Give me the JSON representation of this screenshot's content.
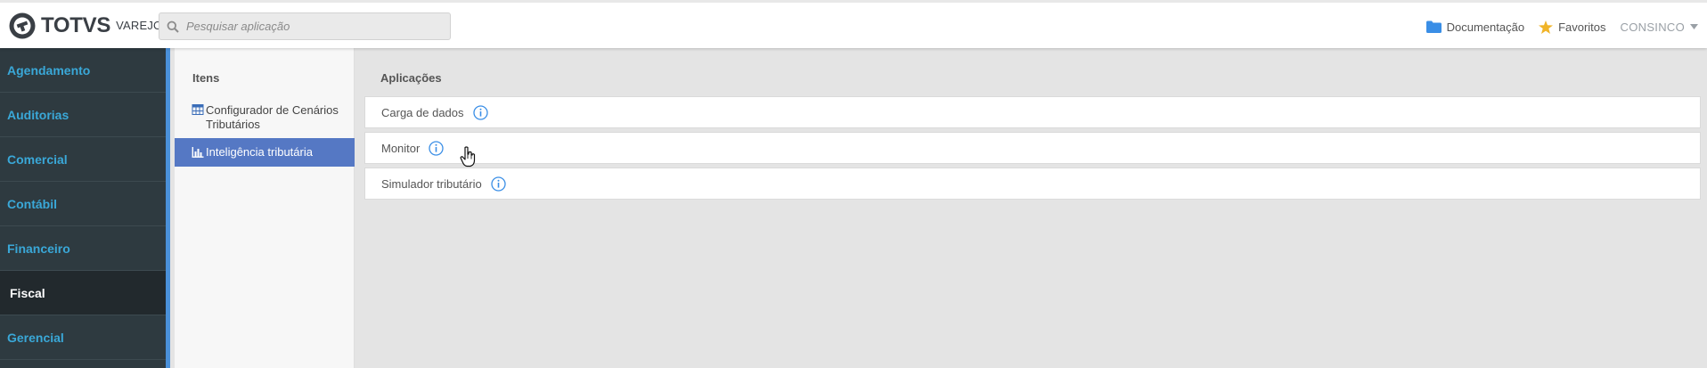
{
  "header": {
    "logo_text": "TOTVS",
    "logo_sub": "VAREJO",
    "search": {
      "placeholder": "Pesquisar aplicação"
    },
    "links": {
      "documentation": "Documentação",
      "favorites": "Favoritos",
      "user": "CONSINCO"
    }
  },
  "sidebar": {
    "items": [
      {
        "label": "Agendamento"
      },
      {
        "label": "Auditorias"
      },
      {
        "label": "Comercial"
      },
      {
        "label": "Contábil"
      },
      {
        "label": "Financeiro"
      },
      {
        "label": "Fiscal",
        "active": true
      },
      {
        "label": "Gerencial"
      }
    ]
  },
  "items_panel": {
    "title": "Itens",
    "items": [
      {
        "label": "Configurador de Cenários Tributários",
        "icon": "table-icon"
      },
      {
        "label": "Inteligência tributária",
        "icon": "bar-chart-icon",
        "active": true
      }
    ]
  },
  "content": {
    "title": "Aplicações",
    "apps": [
      {
        "label": "Carga de dados",
        "icon": "info-icon"
      },
      {
        "label": "Monitor",
        "icon": "info-icon"
      },
      {
        "label": "Simulador tributário",
        "icon": "info-icon"
      }
    ]
  },
  "colors": {
    "sidebar_bg": "#2e3a40",
    "sidebar_link": "#3aa8d8",
    "sidebar_active_bg": "#22292d",
    "accent_blue": "#4a90d9",
    "item_active_bg": "#5578c4",
    "favorite_star": "#f0b428",
    "folder": "#3a8ee6"
  }
}
